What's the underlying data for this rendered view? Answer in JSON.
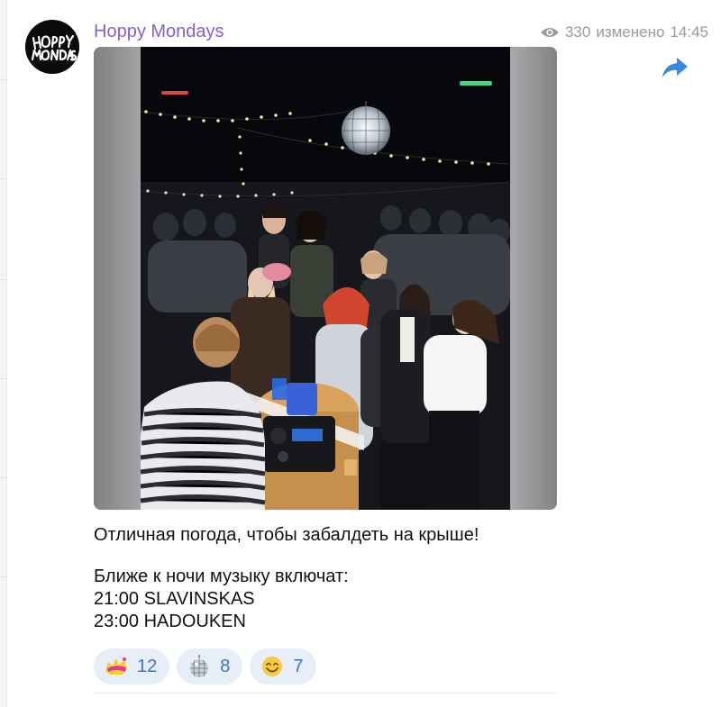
{
  "channel": {
    "name": "Hoppy Mondays",
    "avatar_logo_text": "HOPPY MONDAYS"
  },
  "post": {
    "views": "330",
    "edited_label": "изменено",
    "time": "14:45",
    "media_alt": "photo of a rooftop party crowd at night with a DJ, string lights and a disco ball",
    "text_lines": [
      "Отличная погода, чтобы забалдеть на крыше!",
      "",
      "Ближе к ночи музыку включат:",
      "21:00 SLAVINSKAS",
      "23:00 HADOUKEN"
    ]
  },
  "reactions": [
    {
      "emoji": "hype-sticker",
      "count": "12"
    },
    {
      "emoji": "disco-ball",
      "count": "8"
    },
    {
      "emoji": "smiling-face",
      "count": "7"
    }
  ],
  "colors": {
    "channel_name": "#8a5cd6",
    "meta_text": "#9a9aa0",
    "reaction_bg": "#e7eef8",
    "reaction_count": "#3a74c9",
    "share_icon": "#3b86e0"
  }
}
